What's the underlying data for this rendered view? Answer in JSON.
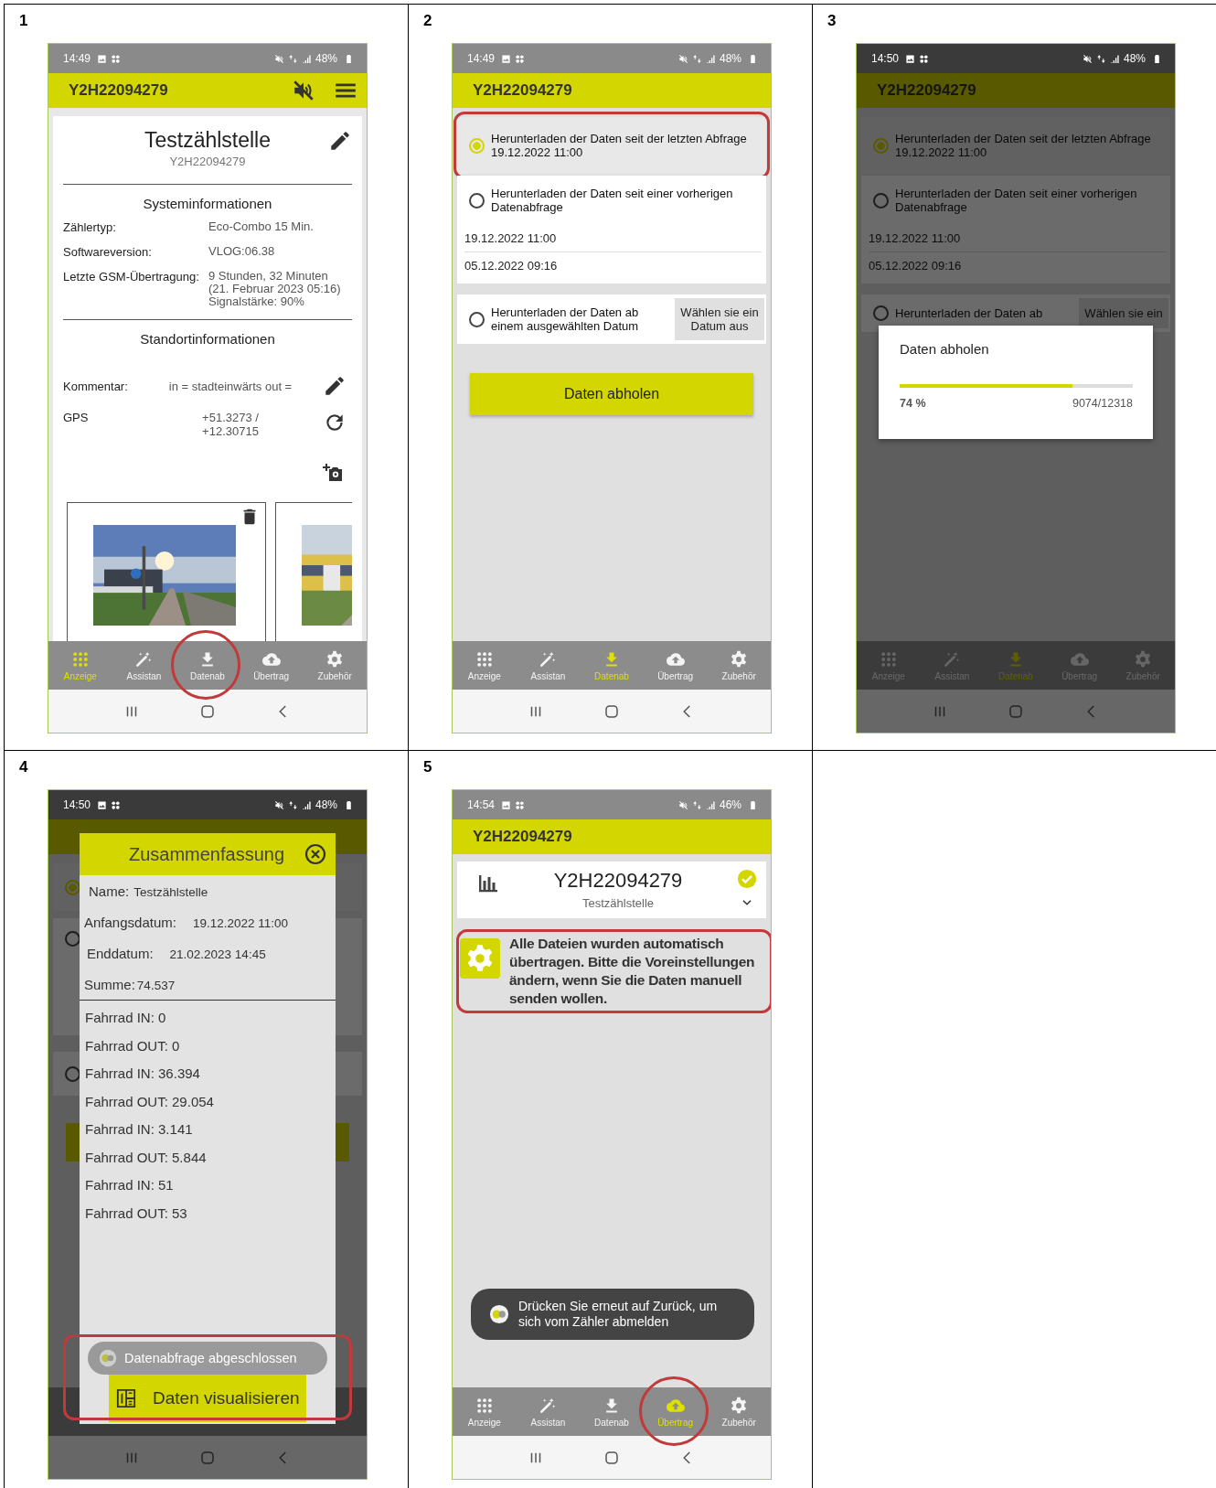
{
  "cells": [
    {
      "number": "1",
      "screen": {
        "kind": "device",
        "dimmed": false,
        "status": {
          "time": "14:49",
          "battery": "48%"
        },
        "app_bar": {
          "title": "Y2H22094279"
        },
        "device": {
          "title": "Testzählstelle",
          "subtitle": "Y2H22094279",
          "system": {
            "title": "Systeminformationen",
            "rows": [
              {
                "label": "Zählertyp:",
                "value": "Eco-Combo 15 Min."
              },
              {
                "label": "Softwareversion:",
                "value": "VLOG:06.38"
              },
              {
                "label": "Letzte GSM-Übertragung:",
                "value": "9 Stunden, 32 Minuten\n(21. Februar 2023 05:16)\nSignalstärke: 90%"
              }
            ]
          },
          "location": {
            "title": "Standortinformationen",
            "comment_label": "Kommentar:",
            "comment": "in = stadteinwärts  out =",
            "gps_label": "GPS",
            "gps": "+51.3273 /\n+12.30715"
          },
          "photos": [
            {
              "kind": "street",
              "deletable": true
            },
            {
              "kind": "tram",
              "deletable": false
            }
          ]
        },
        "nav": [
          {
            "label": "Anzeige",
            "selected": true,
            "circled": false
          },
          {
            "label": "Assistan",
            "selected": false,
            "circled": false
          },
          {
            "label": "Datenab",
            "selected": false,
            "circled": true
          },
          {
            "label": "Übertrag",
            "selected": false,
            "circled": false
          },
          {
            "label": "Zubehör",
            "selected": false,
            "circled": false
          }
        ]
      }
    },
    {
      "number": "2",
      "screen": {
        "kind": "options",
        "dimmed": false,
        "status": {
          "time": "14:49",
          "battery": "48%"
        },
        "app_bar": {
          "title": "Y2H22094279"
        },
        "options": [
          {
            "selected": true,
            "circled": true,
            "label": "Herunterladen der Daten seit der letzten Abfrage",
            "detail": "19.12.2022 11:00"
          },
          {
            "selected": false,
            "circled": false,
            "label": "Herunterladen der Daten seit einer vorherigen Datenabfrage",
            "dates": [
              "19.12.2022 11:00",
              "05.12.2022 09:16"
            ]
          },
          {
            "selected": false,
            "circled": false,
            "label": "Herunterladen der Daten ab einem ausgewählten Datum",
            "button": "Wählen sie ein Datum aus"
          }
        ],
        "action": "Daten abholen",
        "nav": [
          {
            "label": "Anzeige",
            "selected": false,
            "circled": false
          },
          {
            "label": "Assistan",
            "selected": false,
            "circled": false
          },
          {
            "label": "Datenab",
            "selected": true,
            "circled": false
          },
          {
            "label": "Übertrag",
            "selected": false,
            "circled": false
          },
          {
            "label": "Zubehör",
            "selected": false,
            "circled": false
          }
        ]
      }
    },
    {
      "number": "3",
      "screen": {
        "kind": "options",
        "dimmed": true,
        "status": {
          "time": "14:50",
          "battery": "48%"
        },
        "app_bar": {
          "title": "Y2H22094279"
        },
        "options": [
          {
            "selected": true,
            "circled": false,
            "label": "Herunterladen der Daten seit der letzten Abfrage",
            "detail": "19.12.2022 11:00"
          },
          {
            "selected": false,
            "circled": false,
            "label": "Herunterladen der Daten seit einer vorherigen Datenabfrage",
            "dates": [
              "19.12.2022 11:00",
              "05.12.2022 09:16"
            ]
          },
          {
            "selected": false,
            "circled": false,
            "label": "Herunterladen der Daten ab",
            "button": "Wählen sie ein"
          }
        ],
        "nav": [
          {
            "label": "Anzeige",
            "selected": false,
            "circled": false
          },
          {
            "label": "Assistan",
            "selected": false,
            "circled": false
          },
          {
            "label": "Datenab",
            "selected": true,
            "circled": false
          },
          {
            "label": "Übertrag",
            "selected": false,
            "circled": false
          },
          {
            "label": "Zubehör",
            "selected": false,
            "circled": false
          }
        ],
        "dialog": {
          "kind": "progress",
          "title": "Daten abholen",
          "level": 0.74,
          "percent": "74 %",
          "count": "9074/12318"
        }
      }
    },
    {
      "number": "4",
      "screen": {
        "kind": "backdrop",
        "dimmed": true,
        "status": {
          "time": "14:50",
          "battery": "48%"
        },
        "backdrop_options": [
          {
            "selected": true
          },
          {
            "selected": false
          },
          {
            "selected": false
          }
        ],
        "dialog": {
          "kind": "summary",
          "title": "Zusammenfassung",
          "fields": [
            {
              "label": "Name:",
              "value": "Testzählstelle"
            },
            {
              "label": "Anfangsdatum:",
              "value": "19.12.2022 11:00"
            },
            {
              "label": "Enddatum:",
              "value": "21.02.2023 14:45"
            },
            {
              "label": "Summe:",
              "value": "74.537"
            }
          ],
          "counts": [
            "Fahrrad IN: 0",
            "Fahrrad OUT: 0",
            "Fahrrad IN: 36.394",
            "Fahrrad OUT: 29.054",
            "Fahrrad IN: 3.141",
            "Fahrrad OUT: 5.844",
            "Fahrrad IN: 51",
            "Fahrrad OUT: 53"
          ],
          "toast": "Datenabfrage abgeschlossen",
          "button": "Daten visualisieren",
          "circled": true
        }
      }
    },
    {
      "number": "5",
      "screen": {
        "kind": "transfer",
        "dimmed": false,
        "status": {
          "time": "14:54",
          "battery": "46%"
        },
        "app_bar": {
          "title": "Y2H22094279"
        },
        "device_card": {
          "title": "Y2H22094279",
          "subtitle": "Testzählstelle",
          "connected": true
        },
        "message": {
          "text": "Alle Dateien wurden automatisch übertragen. Bitte die Voreinstellungen ändern, wenn Sie die Daten manuell senden wollen.",
          "circled": true
        },
        "toast": "Drücken Sie erneut auf Zurück, um sich vom Zähler abmelden",
        "nav": [
          {
            "label": "Anzeige",
            "selected": false,
            "circled": false
          },
          {
            "label": "Assistan",
            "selected": false,
            "circled": false
          },
          {
            "label": "Datenab",
            "selected": false,
            "circled": false
          },
          {
            "label": "Übertrag",
            "selected": true,
            "circled": true
          },
          {
            "label": "Zubehör",
            "selected": false,
            "circled": false
          }
        ]
      }
    }
  ]
}
